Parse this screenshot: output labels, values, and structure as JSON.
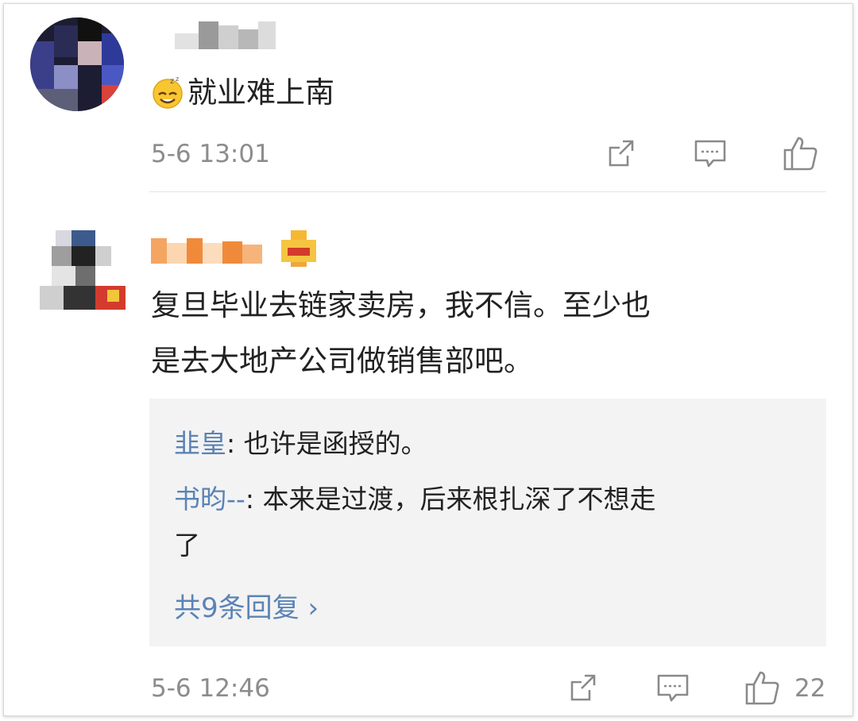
{
  "comments": [
    {
      "text": "就业难上南",
      "emoji": "doze-smile-emoji",
      "time": "5-6 13:01",
      "like_count": ""
    },
    {
      "text_line1": "复旦毕业去链家卖房，我不信。至少也",
      "text_line2": "是去大地产公司做销售部吧。",
      "time": "5-6 12:46",
      "like_count": "22",
      "replies": [
        {
          "name": "韭皇",
          "sep": ": ",
          "text": "也许是函授的。"
        },
        {
          "name": "书昀--",
          "sep": ": ",
          "text_line1": "本来是过渡，后来根扎深了不想走",
          "text_line2": "了"
        }
      ],
      "more_replies": "共9条回复 ›"
    }
  ],
  "colors": {
    "link": "#5b83b6",
    "meta": "#8c8c8c",
    "reply_bg": "#f3f3f3"
  }
}
